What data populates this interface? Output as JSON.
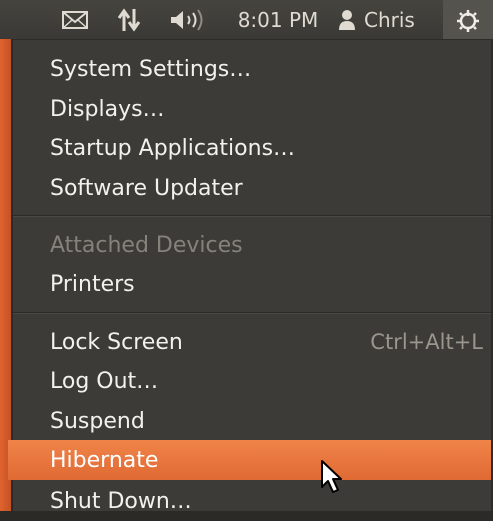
{
  "panel": {
    "clock": "8:01 PM",
    "user_name": "Chris",
    "icons": [
      "mail-icon",
      "network-icon",
      "sound-icon",
      "user-icon",
      "session-gear-icon"
    ]
  },
  "menu": {
    "items": [
      {
        "label": "System Settings…"
      },
      {
        "label": "Displays…"
      },
      {
        "label": "Startup Applications…"
      },
      {
        "label": "Software Updater"
      },
      {
        "label": "Attached Devices",
        "disabled": true
      },
      {
        "label": "Printers"
      },
      {
        "label": "Lock Screen",
        "shortcut": "Ctrl+Alt+L"
      },
      {
        "label": "Log Out…"
      },
      {
        "label": "Suspend"
      },
      {
        "label": "Hibernate",
        "highlighted": true
      },
      {
        "label": "Shut Down…"
      }
    ]
  },
  "colors": {
    "accent": "#e9743c",
    "menu_bg": "#3c3b37",
    "panel_bg": "#3f3e3a",
    "text": "#f2f1ee",
    "disabled_text": "#85827b"
  }
}
